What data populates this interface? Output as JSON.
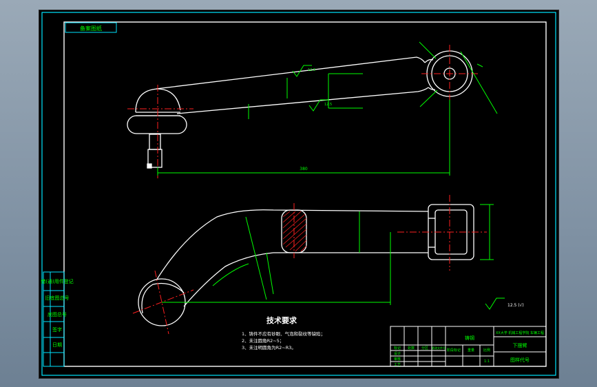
{
  "drawing": {
    "top_left_stamp": "备案图纸",
    "tech_req": {
      "title": "技术要求",
      "items": [
        "1、铸件不应有砂眼、气泡和裂纹等缺陷；",
        "2、未注圆角R2~5；",
        "3、未注明圆角为R2~R3。"
      ]
    },
    "dims": {
      "overall_length": "380",
      "surface_finish_1": "12.5",
      "surface_finish_2": "12.5",
      "surface_finish_3": "12.5 (√)"
    },
    "side_labels": [
      "借(通)用件登记",
      "旧底图总号",
      "底图总号",
      "签字",
      "日期"
    ],
    "title_block": {
      "name": "下摆臂",
      "material": "铸钢",
      "drawing_no": "图样代号",
      "company": "XX大学 机械工程学院 车辆工程",
      "headers": [
        "标记",
        "处数",
        "分区",
        "更改文件号",
        "签名",
        "年月日"
      ],
      "rows": [
        "设计",
        "审核",
        "工艺",
        "批准"
      ],
      "stage": "阶段标记",
      "weight": "重量",
      "scale": "比例",
      "scale_val": "1:1"
    }
  },
  "colors": {
    "outline": "#ffffff",
    "dimension": "#00ff00",
    "center": "#ff2020",
    "frame": "#00e5ff",
    "text": "#ffffff"
  }
}
